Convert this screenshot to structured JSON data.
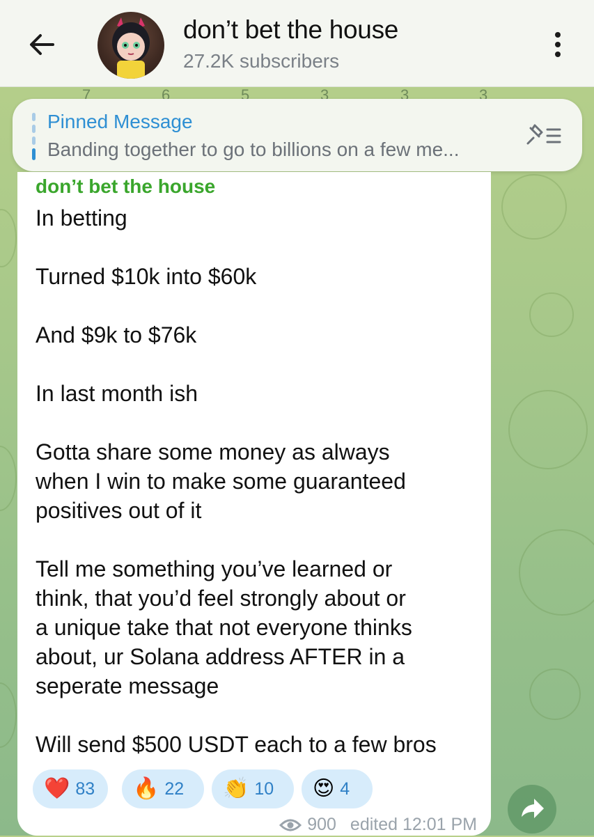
{
  "header": {
    "channel_name": "don’t bet the house",
    "subscribers": "27.2K subscribers"
  },
  "peek_reactions": [
    "7",
    "6",
    "5",
    "3",
    "3",
    "3"
  ],
  "pinned": {
    "title": "Pinned Message",
    "text": "Banding together to go to billions on a few me..."
  },
  "message": {
    "author": "don’t bet the house",
    "lines": [
      "In betting",
      "Turned $10k into $60k",
      "And $9k to $76k",
      "In last month ish",
      "Gotta share some money as always",
      "when I win to make some guaranteed",
      "positives out of it",
      "Tell me something you’ve learned or",
      "think, that you’d feel strongly about or",
      "a unique take that not everyone thinks",
      "about, ur Solana address AFTER in a",
      "seperate message",
      "Will send $500 USDT each to a few bros"
    ],
    "reactions": [
      {
        "emoji": "❤️",
        "count": "83",
        "icon": "heart-icon"
      },
      {
        "emoji": "🔥",
        "count": "22",
        "icon": "fire-icon"
      },
      {
        "emoji": "👏",
        "count": "10",
        "icon": "clap-icon"
      },
      {
        "emoji": "😍",
        "count": "4",
        "icon": "heart-eyes-icon"
      }
    ],
    "views": "900",
    "edited_time": "edited 12:01 PM"
  }
}
